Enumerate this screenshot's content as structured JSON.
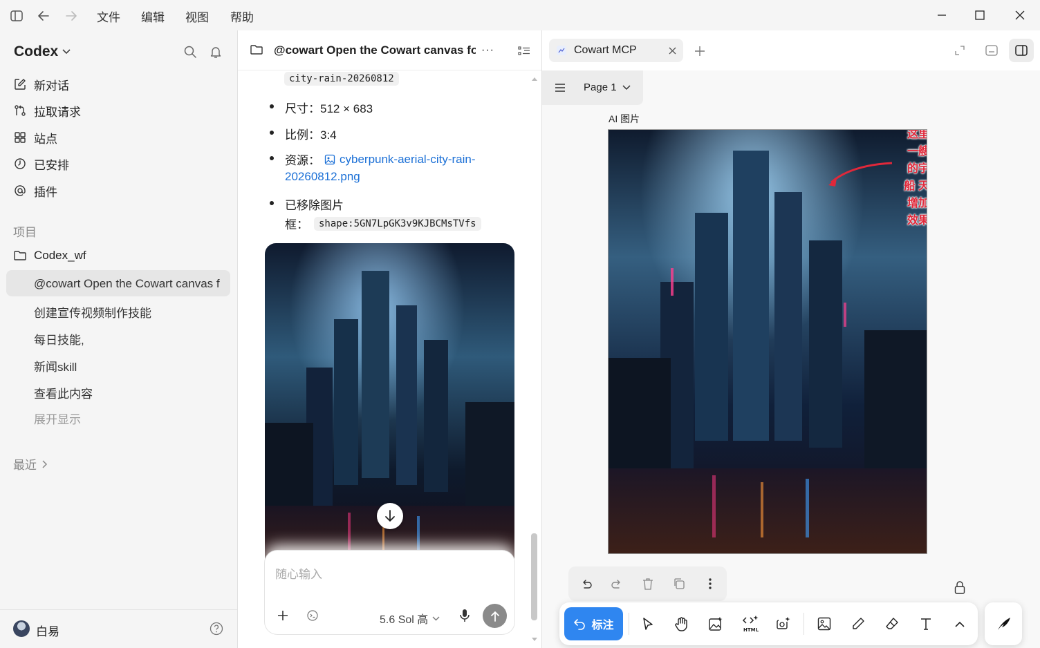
{
  "menu": [
    "文件",
    "编辑",
    "视图",
    "帮助"
  ],
  "sidebar": {
    "brand": "Codex",
    "nav": [
      {
        "label": "新对话",
        "icon": "edit-icon"
      },
      {
        "label": "拉取请求",
        "icon": "pull-request-icon"
      },
      {
        "label": "站点",
        "icon": "grid-icon"
      },
      {
        "label": "已安排",
        "icon": "clock-icon"
      },
      {
        "label": "插件",
        "icon": "at-icon"
      }
    ],
    "projects_label": "项目",
    "project_name": "Codex_wf",
    "threads": [
      "@cowart Open the Cowart canvas f",
      "创建宣传视频制作技能",
      "每日技能,",
      "新闻skill",
      "查看此内容"
    ],
    "show_more": "展开显示",
    "recent_label": "最近",
    "user_name": "白易"
  },
  "chat": {
    "title": "@cowart Open the Cowart canvas fo",
    "code_filename": "city-rain-20260812",
    "size_line": "尺寸：512 × 683",
    "ratio_line": "比例：3:4",
    "resource_label": "资源：",
    "resource_link_1": "cyberpunk-aerial-city-rain-",
    "resource_link_2": "20260812.png",
    "removed_line_1": "已移除图片",
    "removed_line_2": "框：",
    "shape_id": "shape:5GN7LpGK3v9KJBCMsTVfs",
    "input_placeholder": "随心输入",
    "model_label": "5.6 Sol 高"
  },
  "canvas": {
    "tab_label": "Cowart MCP",
    "page_label": "Page 1",
    "frame_label": "AI 图片",
    "annotation_lines": [
      "这里",
      "一艘",
      "的宇",
      "船 天",
      "增加",
      "效果"
    ],
    "annotate_button": "标注"
  },
  "colors": {
    "accent": "#2f86f0",
    "link": "#1a6fd6",
    "annotation": "#e0283a"
  }
}
